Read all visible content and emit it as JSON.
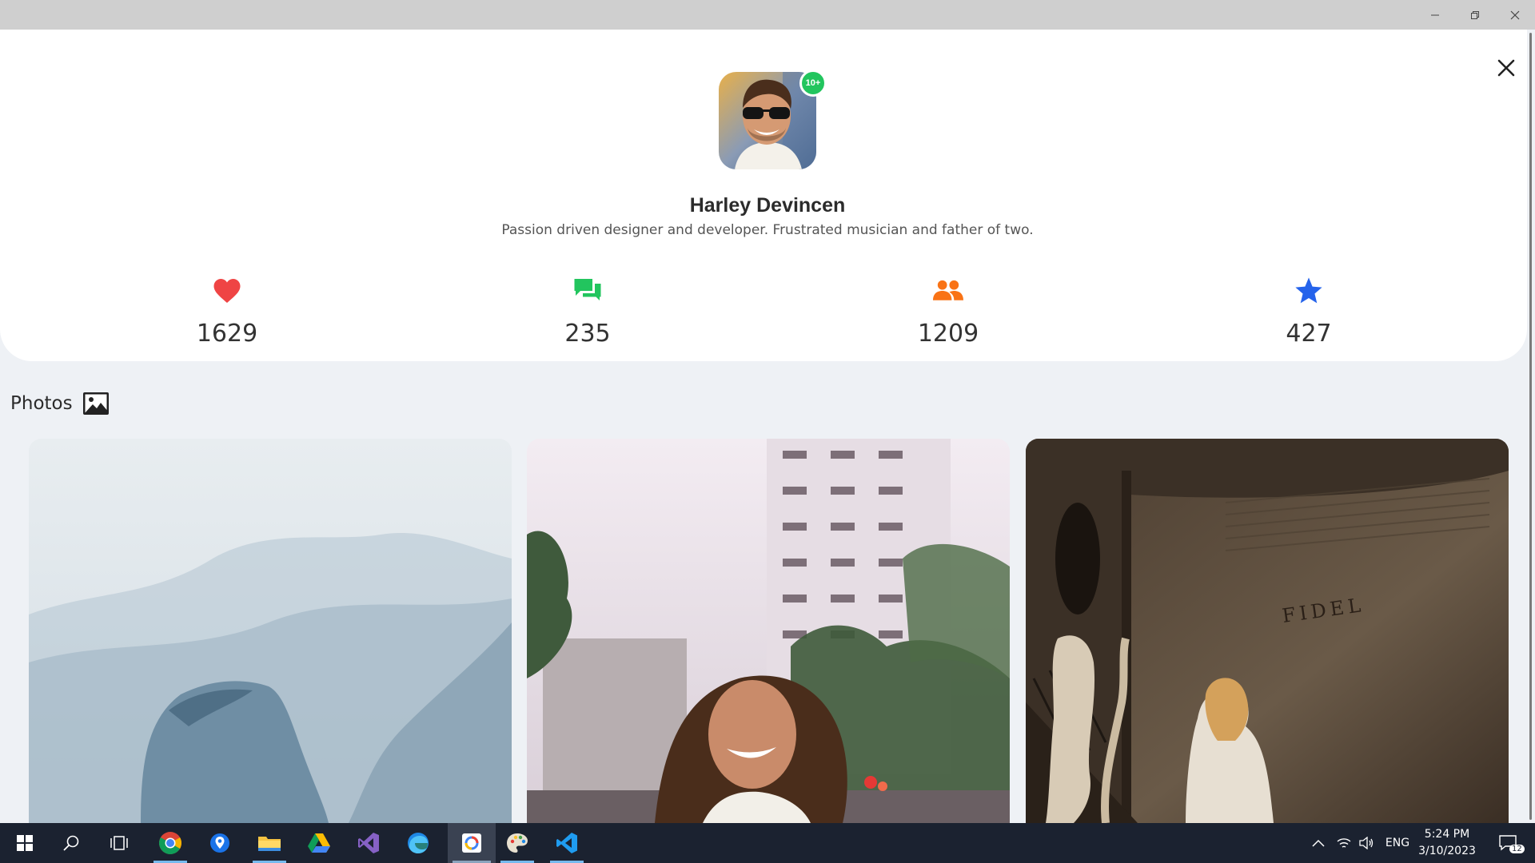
{
  "window": {
    "controls": [
      "minimize-icon",
      "restore-icon",
      "close-icon"
    ]
  },
  "profile": {
    "name": "Harley Devincen",
    "bio": "Passion driven designer and developer. Frustrated musician and father of two.",
    "badge": "10+",
    "badge_color": "#22c55e"
  },
  "stats": [
    {
      "icon": "heart-icon",
      "value": "1629",
      "color": "#ef4444"
    },
    {
      "icon": "chat-icon",
      "value": "235",
      "color": "#22c55e"
    },
    {
      "icon": "people-icon",
      "value": "1209",
      "color": "#f97316"
    },
    {
      "icon": "star-icon",
      "value": "427",
      "color": "#2563eb"
    }
  ],
  "photos": {
    "title": "Photos",
    "images": [
      "misty-mountains-photo",
      "smiling-woman-city-photo",
      "woman-statue-fidel-wall-photo"
    ],
    "photo_3_caption": "FIDEL"
  },
  "taskbar": {
    "apps": [
      "start-icon",
      "search-icon",
      "task-view-icon",
      "chrome-icon",
      "maps-icon",
      "file-explorer-icon",
      "google-drive-icon",
      "visual-studio-icon",
      "edge-icon",
      "app-icon",
      "paint-icon",
      "vscode-icon"
    ],
    "language": "ENG",
    "time": "5:24 PM",
    "date": "3/10/2023",
    "notification_count": "12"
  }
}
